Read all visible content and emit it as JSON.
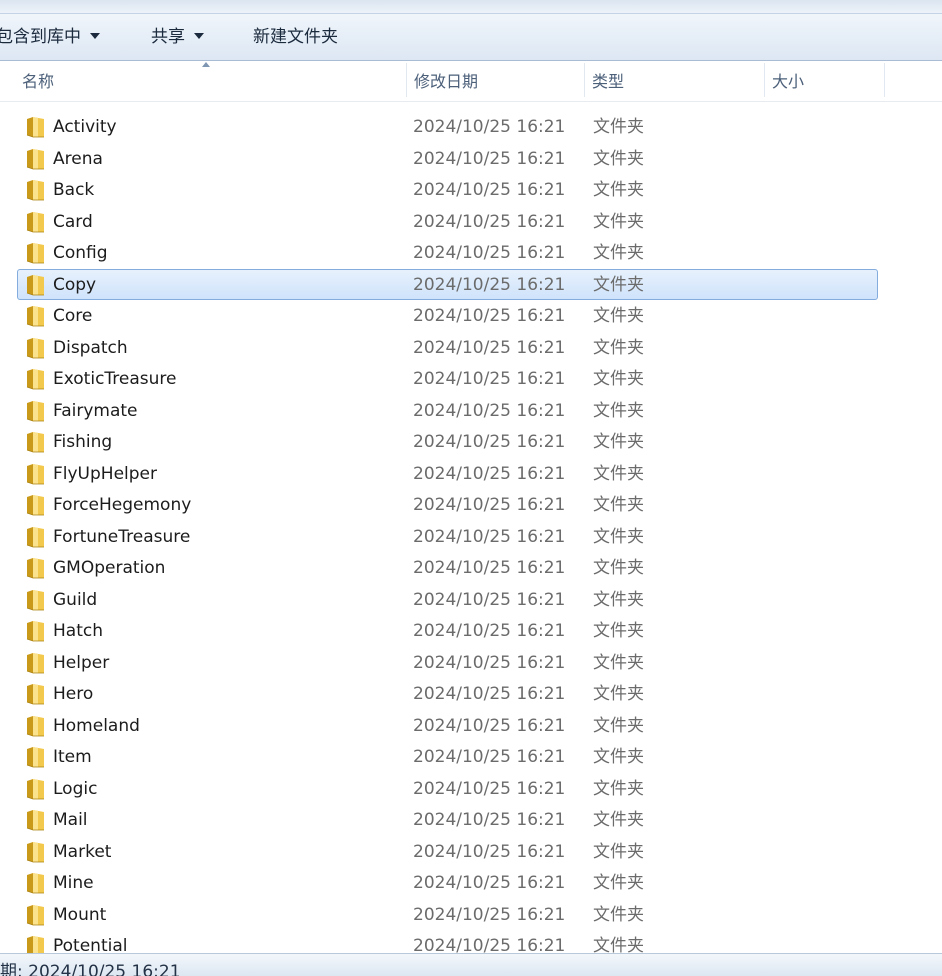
{
  "toolbar": {
    "include_label": "包含到库中",
    "share_label": "共享",
    "new_folder_label": "新建文件夹"
  },
  "columns": {
    "name": "名称",
    "modified": "修改日期",
    "type": "类型",
    "size": "大小"
  },
  "files": [
    {
      "name": "Activity",
      "modified": "2024/10/25 16:21",
      "type": "文件夹",
      "size": "",
      "selected": false
    },
    {
      "name": "Arena",
      "modified": "2024/10/25 16:21",
      "type": "文件夹",
      "size": "",
      "selected": false
    },
    {
      "name": "Back",
      "modified": "2024/10/25 16:21",
      "type": "文件夹",
      "size": "",
      "selected": false
    },
    {
      "name": "Card",
      "modified": "2024/10/25 16:21",
      "type": "文件夹",
      "size": "",
      "selected": false
    },
    {
      "name": "Config",
      "modified": "2024/10/25 16:21",
      "type": "文件夹",
      "size": "",
      "selected": false
    },
    {
      "name": "Copy",
      "modified": "2024/10/25 16:21",
      "type": "文件夹",
      "size": "",
      "selected": true
    },
    {
      "name": "Core",
      "modified": "2024/10/25 16:21",
      "type": "文件夹",
      "size": "",
      "selected": false
    },
    {
      "name": "Dispatch",
      "modified": "2024/10/25 16:21",
      "type": "文件夹",
      "size": "",
      "selected": false
    },
    {
      "name": "ExoticTreasure",
      "modified": "2024/10/25 16:21",
      "type": "文件夹",
      "size": "",
      "selected": false
    },
    {
      "name": "Fairymate",
      "modified": "2024/10/25 16:21",
      "type": "文件夹",
      "size": "",
      "selected": false
    },
    {
      "name": "Fishing",
      "modified": "2024/10/25 16:21",
      "type": "文件夹",
      "size": "",
      "selected": false
    },
    {
      "name": "FlyUpHelper",
      "modified": "2024/10/25 16:21",
      "type": "文件夹",
      "size": "",
      "selected": false
    },
    {
      "name": "ForceHegemony",
      "modified": "2024/10/25 16:21",
      "type": "文件夹",
      "size": "",
      "selected": false
    },
    {
      "name": "FortuneTreasure",
      "modified": "2024/10/25 16:21",
      "type": "文件夹",
      "size": "",
      "selected": false
    },
    {
      "name": "GMOperation",
      "modified": "2024/10/25 16:21",
      "type": "文件夹",
      "size": "",
      "selected": false
    },
    {
      "name": "Guild",
      "modified": "2024/10/25 16:21",
      "type": "文件夹",
      "size": "",
      "selected": false
    },
    {
      "name": "Hatch",
      "modified": "2024/10/25 16:21",
      "type": "文件夹",
      "size": "",
      "selected": false
    },
    {
      "name": "Helper",
      "modified": "2024/10/25 16:21",
      "type": "文件夹",
      "size": "",
      "selected": false
    },
    {
      "name": "Hero",
      "modified": "2024/10/25 16:21",
      "type": "文件夹",
      "size": "",
      "selected": false
    },
    {
      "name": "Homeland",
      "modified": "2024/10/25 16:21",
      "type": "文件夹",
      "size": "",
      "selected": false
    },
    {
      "name": "Item",
      "modified": "2024/10/25 16:21",
      "type": "文件夹",
      "size": "",
      "selected": false
    },
    {
      "name": "Logic",
      "modified": "2024/10/25 16:21",
      "type": "文件夹",
      "size": "",
      "selected": false
    },
    {
      "name": "Mail",
      "modified": "2024/10/25 16:21",
      "type": "文件夹",
      "size": "",
      "selected": false
    },
    {
      "name": "Market",
      "modified": "2024/10/25 16:21",
      "type": "文件夹",
      "size": "",
      "selected": false
    },
    {
      "name": "Mine",
      "modified": "2024/10/25 16:21",
      "type": "文件夹",
      "size": "",
      "selected": false
    },
    {
      "name": "Mount",
      "modified": "2024/10/25 16:21",
      "type": "文件夹",
      "size": "",
      "selected": false
    },
    {
      "name": "Potential",
      "modified": "2024/10/25 16:21",
      "type": "文件夹",
      "size": "",
      "selected": false
    }
  ],
  "status_bar": {
    "text": "期: 2024/10/25 16:21"
  },
  "colors": {
    "selection_fill": "#cfe3fb",
    "selection_border": "#84acdd",
    "folder_body": "#f2c94c",
    "folder_shade": "#c99a1a"
  },
  "icons": {
    "folder": "folder-icon",
    "dropdown": "chevron-down-icon",
    "sort": "sort-ascending-icon"
  }
}
